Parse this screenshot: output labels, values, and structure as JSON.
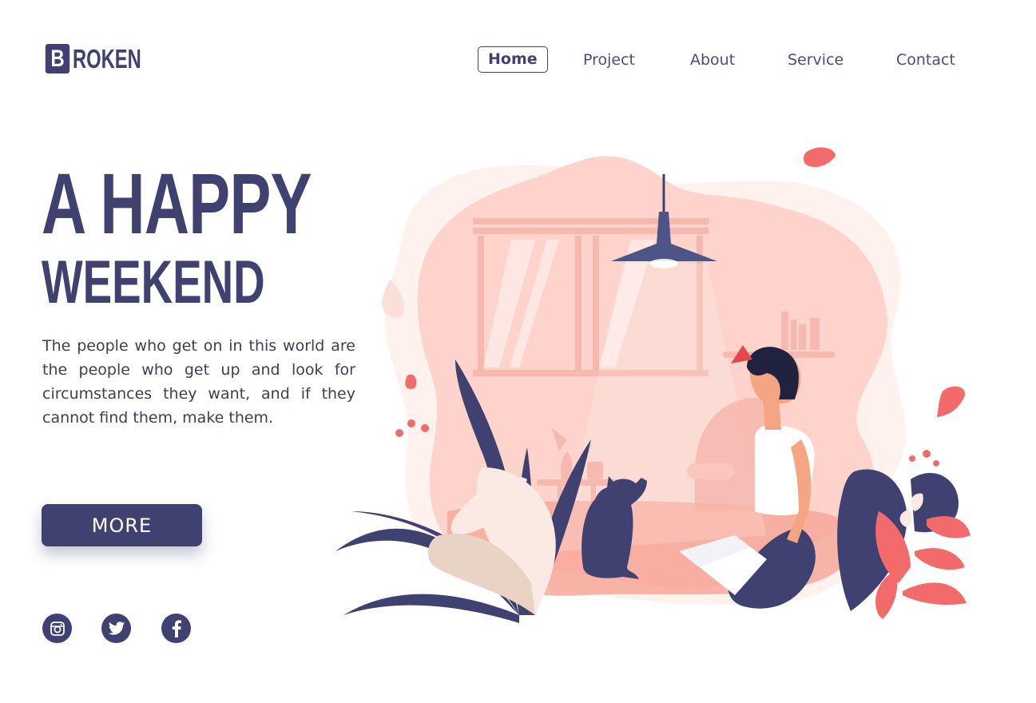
{
  "logo": {
    "initial": "B",
    "text": "ROKEN"
  },
  "nav": {
    "items": [
      {
        "label": "Home",
        "active": true
      },
      {
        "label": "Project",
        "active": false
      },
      {
        "label": "About",
        "active": false
      },
      {
        "label": "Service",
        "active": false
      },
      {
        "label": "Contact",
        "active": false
      }
    ]
  },
  "hero": {
    "title_line1": "A HAPPY",
    "title_line2": "WEEKEND",
    "description": "The people who get on in this world are the people who get up and look for circumstances they want, and if they cannot find them, make them.",
    "button_label": "MORE"
  },
  "social": [
    {
      "icon": "instagram-icon"
    },
    {
      "icon": "twitter-icon"
    },
    {
      "icon": "facebook-icon"
    }
  ],
  "colors": {
    "primary": "#3f4270",
    "accent": "#f26a6a",
    "blob": "#fdd3cc",
    "floor": "#f7a89a"
  }
}
